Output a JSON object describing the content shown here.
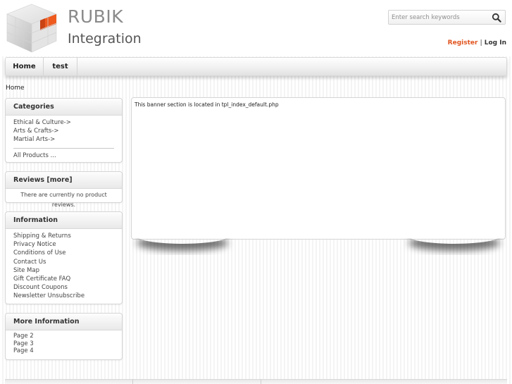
{
  "header": {
    "brand_line1": "RUBIK",
    "brand_line2": "Integration",
    "search_placeholder": "Enter search keywords",
    "register_label": "Register",
    "separator": "|",
    "login_label": "Log In"
  },
  "nav": {
    "items": [
      {
        "label": "Home"
      },
      {
        "label": "test"
      }
    ]
  },
  "breadcrumb": "Home",
  "sidebar": {
    "categories": {
      "title": "Categories",
      "items": [
        "Ethical & Culture->",
        "Arts & Crafts->",
        "Martial Arts->"
      ],
      "all_products": "All Products ..."
    },
    "reviews": {
      "title": "Reviews  [more]",
      "message": "There are currently no product reviews."
    },
    "information": {
      "title": "Information",
      "items": [
        "Shipping & Returns",
        "Privacy Notice",
        "Conditions of Use",
        "Contact Us",
        "Site Map",
        "Gift Certificate FAQ",
        "Discount Coupons",
        "Newsletter Unsubscribe"
      ]
    },
    "more_information": {
      "title": "More Information",
      "items": [
        "Page 2",
        "Page 3",
        "Page 4"
      ]
    }
  },
  "main": {
    "banner_text": "This banner section is located in tpl_index_default.php"
  },
  "colors": {
    "accent": "#e1541f",
    "text": "#333333"
  }
}
